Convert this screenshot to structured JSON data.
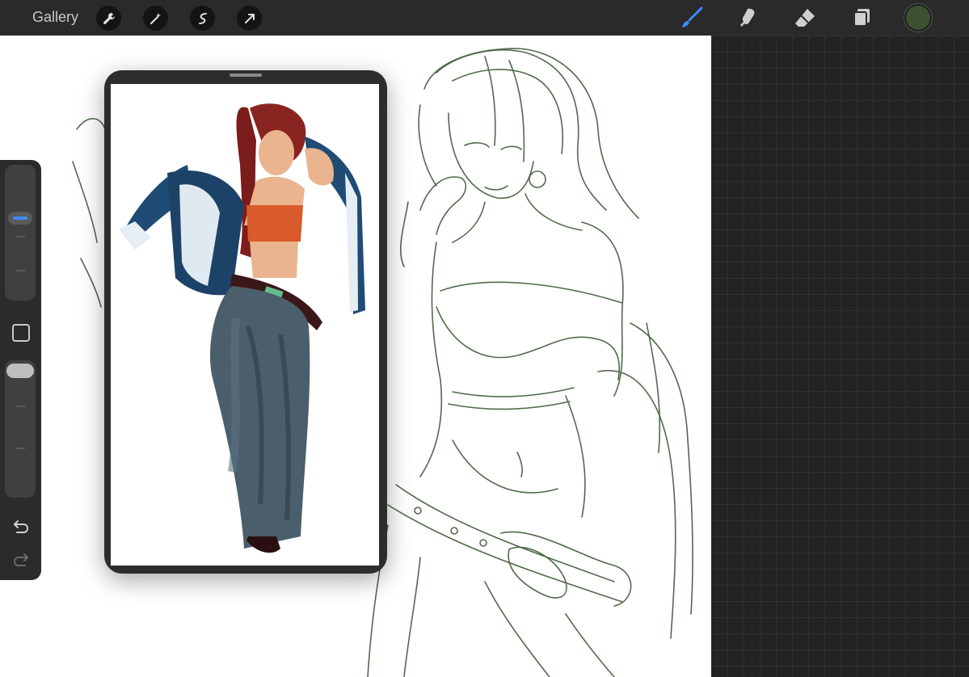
{
  "topbar": {
    "gallery_label": "Gallery",
    "left_tools": [
      "wrench-icon",
      "magic-wand-icon",
      "selection-icon",
      "transform-arrow-icon"
    ],
    "right_tools": [
      "brush-icon",
      "smudge-icon",
      "eraser-icon",
      "layers-icon"
    ],
    "active_tool": "brush-icon",
    "current_color": "#3b5132"
  },
  "sidebar": {
    "items": [
      "brush-size-slider",
      "modify-square-button",
      "opacity-slider",
      "undo-icon",
      "redo-icon"
    ]
  },
  "colors": {
    "accent": "#3c8cff",
    "sketch_stroke": "#3e5a38",
    "background_grid": "#232323"
  }
}
